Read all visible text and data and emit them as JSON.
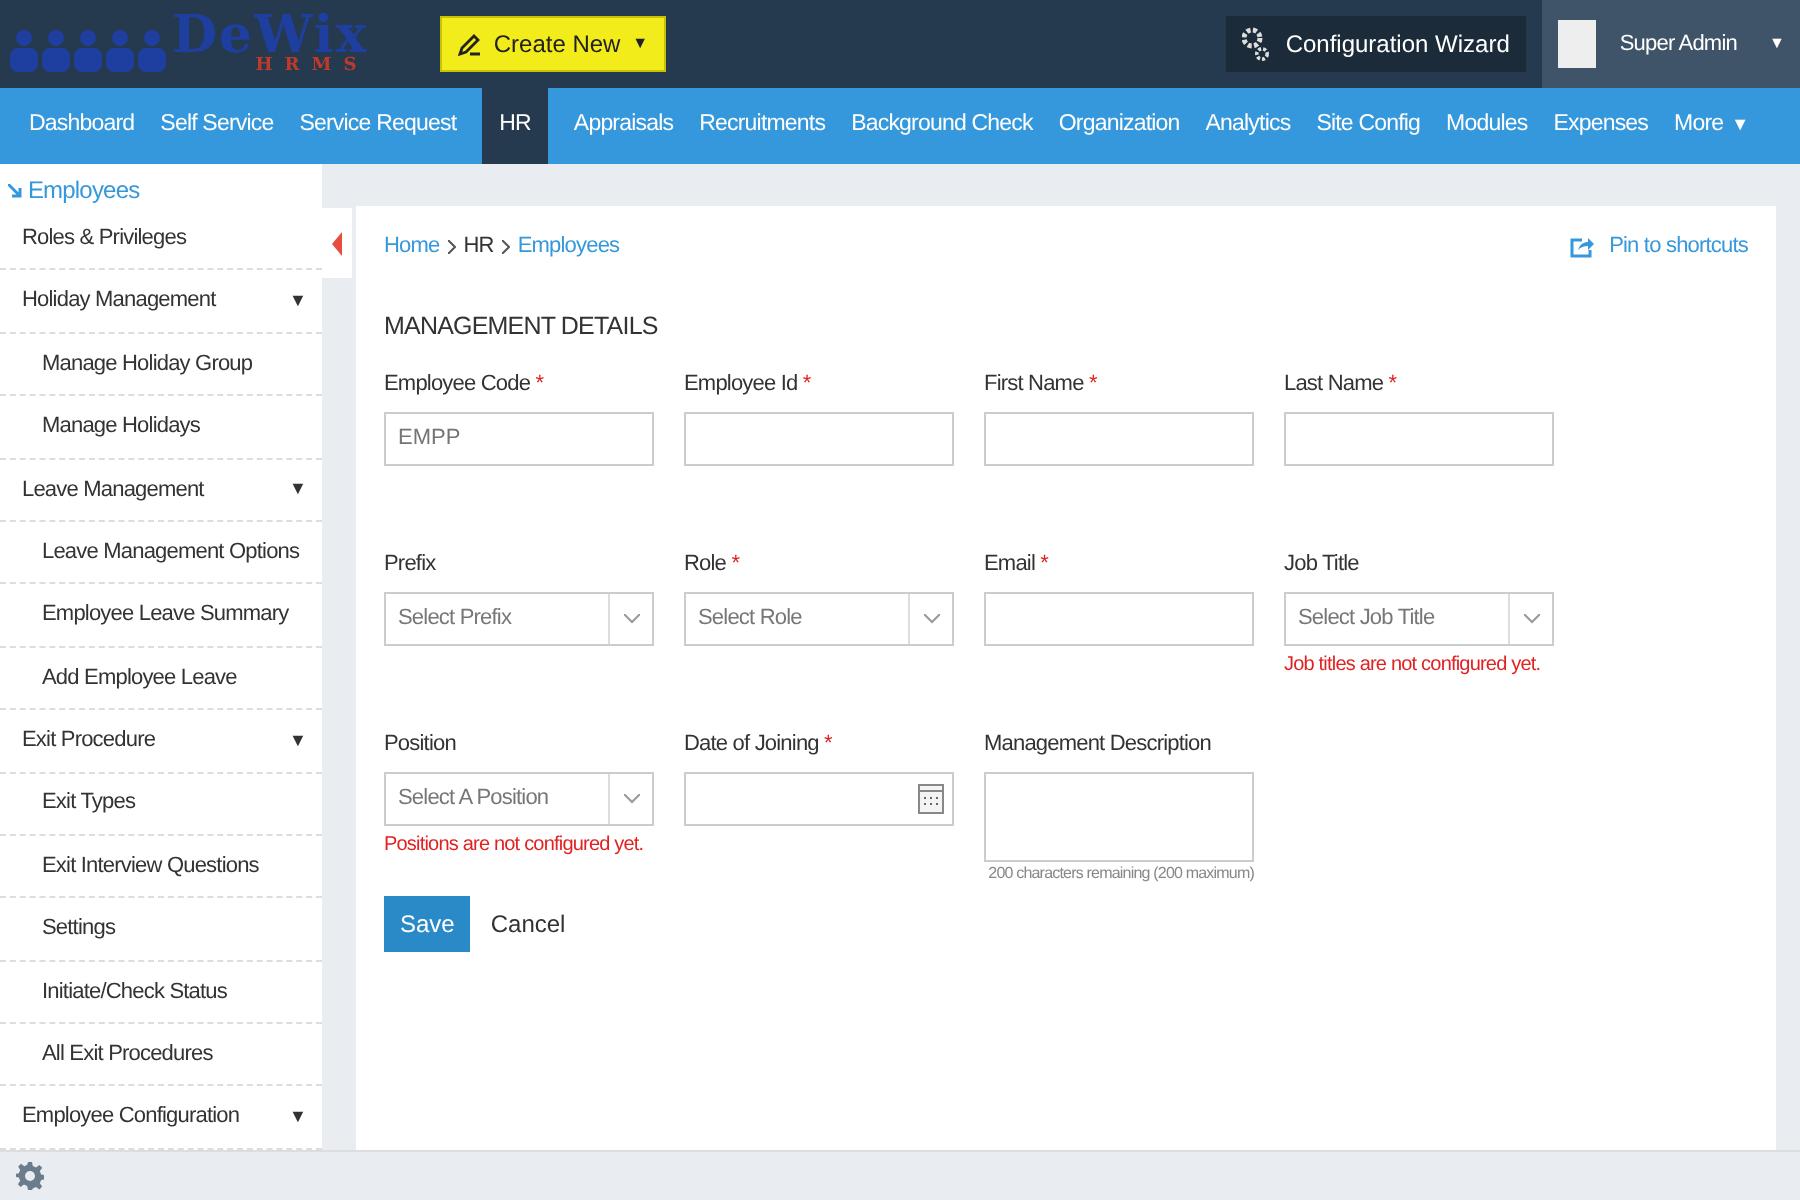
{
  "header": {
    "logo_text": "DeWix",
    "logo_subtext": "HRMS",
    "create_button": "Create New",
    "create_caret": "▼",
    "config_button": "Configuration Wizard",
    "user_name": "Super Admin",
    "user_caret": "▼"
  },
  "nav": [
    {
      "label": "Dashboard",
      "selected": false
    },
    {
      "label": "Self Service",
      "selected": false
    },
    {
      "label": "Service Request",
      "selected": false
    },
    {
      "label": "HR",
      "selected": true
    },
    {
      "label": "Appraisals",
      "selected": false
    },
    {
      "label": "Recruitments",
      "selected": false
    },
    {
      "label": "Background Check",
      "selected": false
    },
    {
      "label": "Organization",
      "selected": false
    },
    {
      "label": "Analytics",
      "selected": false
    },
    {
      "label": "Site Config",
      "selected": false
    },
    {
      "label": "Modules",
      "selected": false
    },
    {
      "label": "Expenses",
      "selected": false
    },
    {
      "label": "More",
      "selected": false,
      "caret": "▼"
    }
  ],
  "sidebar": {
    "title": "Employees",
    "items": [
      {
        "label": "Roles & Privileges"
      },
      {
        "label": "Holiday Management",
        "caret": "▼",
        "children": [
          {
            "label": "Manage Holiday Group"
          },
          {
            "label": "Manage Holidays"
          }
        ]
      },
      {
        "label": "Leave Management",
        "caret": "▼",
        "children": [
          {
            "label": "Leave Management Options"
          },
          {
            "label": "Employee Leave Summary"
          },
          {
            "label": "Add Employee Leave"
          }
        ]
      },
      {
        "label": "Exit Procedure",
        "caret": "▼",
        "children": [
          {
            "label": "Exit Types"
          },
          {
            "label": "Exit Interview Questions"
          },
          {
            "label": "Settings"
          },
          {
            "label": "Initiate/Check Status"
          },
          {
            "label": "All Exit Procedures"
          }
        ]
      },
      {
        "label": "Employee Configuration",
        "caret": "▼"
      }
    ]
  },
  "breadcrumb": [
    {
      "label": "Home",
      "kind": "link"
    },
    {
      "label": "HR",
      "kind": "text"
    },
    {
      "label": "Employees",
      "kind": "link"
    }
  ],
  "pin_link": "Pin to shortcuts",
  "section_title": "MANAGEMENT DETAILS",
  "fields": [
    {
      "label": "Employee Code",
      "required_mark": "*",
      "kind": "text",
      "placeholder": "EMPP"
    },
    {
      "label": "Employee Id",
      "required_mark": "*",
      "kind": "text"
    },
    {
      "label": "First Name",
      "required_mark": "*",
      "kind": "text"
    },
    {
      "label": "Last Name",
      "required_mark": "*",
      "kind": "text"
    },
    {
      "label": "Prefix",
      "kind": "select",
      "placeholder": "Select Prefix"
    },
    {
      "label": "Role",
      "required_mark": "*",
      "kind": "select",
      "placeholder": "Select Role"
    },
    {
      "label": "Email",
      "required_mark": "*",
      "kind": "text"
    },
    {
      "label": "Job Title",
      "kind": "select",
      "placeholder": "Select Job Title",
      "error": "Job titles are not configured yet."
    },
    {
      "label": "Position",
      "kind": "select",
      "placeholder": "Select A Position",
      "error": "Positions are not configured yet."
    },
    {
      "label": "Date of Joining",
      "required_mark": "*",
      "kind": "date"
    },
    {
      "label": "Management Description",
      "kind": "textarea",
      "hint": "200 characters remaining (200 maximum)"
    }
  ],
  "buttons": [
    {
      "label": "Save",
      "kind": "primary"
    },
    {
      "label": "Cancel",
      "kind": "link"
    }
  ]
}
